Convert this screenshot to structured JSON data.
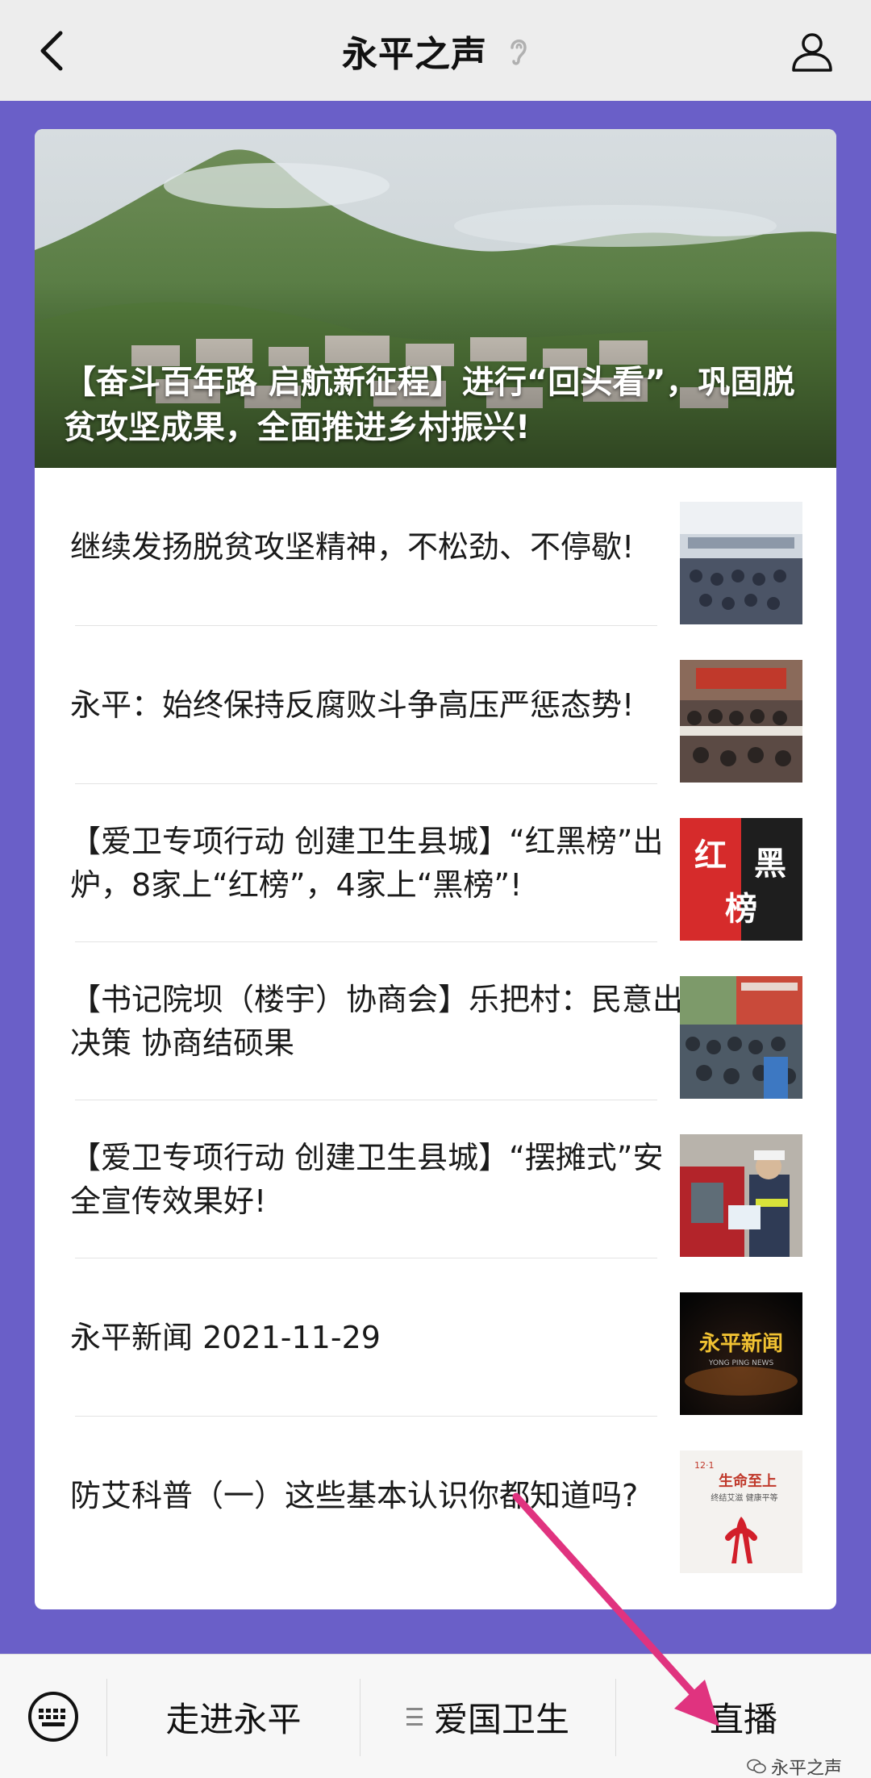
{
  "header": {
    "title": "永平之声"
  },
  "hero": {
    "title": "【奋斗百年路 启航新征程】进行“回头看”，巩固脱贫攻坚成果，全面推进乡村振兴!"
  },
  "articles": [
    {
      "title": "继续发扬脱贫攻坚精神，不松劲、不停歇!",
      "thumb": "meeting-hall-photo"
    },
    {
      "title": "永平：始终保持反腐败斗争高压严惩态势!",
      "thumb": "conference-photo"
    },
    {
      "title": "【爱卫专项行动 创建卫生县城】“红黑榜”出炉，8家上“红榜”，4家上“黑榜”!",
      "thumb": "red-black-list-graphic",
      "thumb_text": [
        "红",
        "黑",
        "榜"
      ]
    },
    {
      "title": "【书记院坝（楼宇）协商会】乐把村：民意出决策 协商结硕果",
      "thumb": "village-meeting-photo"
    },
    {
      "title": "【爱卫专项行动 创建卫生县城】“摆摊式”安全宣传效果好!",
      "thumb": "police-truck-photo"
    },
    {
      "title": "永平新闻 2021-11-29",
      "thumb": "news-logo-graphic",
      "thumb_text": [
        "永平新闻",
        "YONG PING NEWS"
      ]
    },
    {
      "title": "防艾科普（一）这些基本认识你都知道吗?",
      "thumb": "aids-poster-graphic",
      "thumb_text": [
        "生命至上",
        "终结艾滋 健康平等",
        "12·1"
      ]
    }
  ],
  "bottom_menu": {
    "items": [
      {
        "label": "走进永平",
        "has_submenu": false
      },
      {
        "label": "爱国卫生",
        "has_submenu": true
      },
      {
        "label": "直播",
        "has_submenu": false
      }
    ]
  },
  "watermark": {
    "text": "永平之声"
  },
  "colors": {
    "page_bg": "#6a5fc8",
    "topbar_bg": "#ededed",
    "card_bg": "#ffffff",
    "annotation_arrow": "#e0337f"
  }
}
